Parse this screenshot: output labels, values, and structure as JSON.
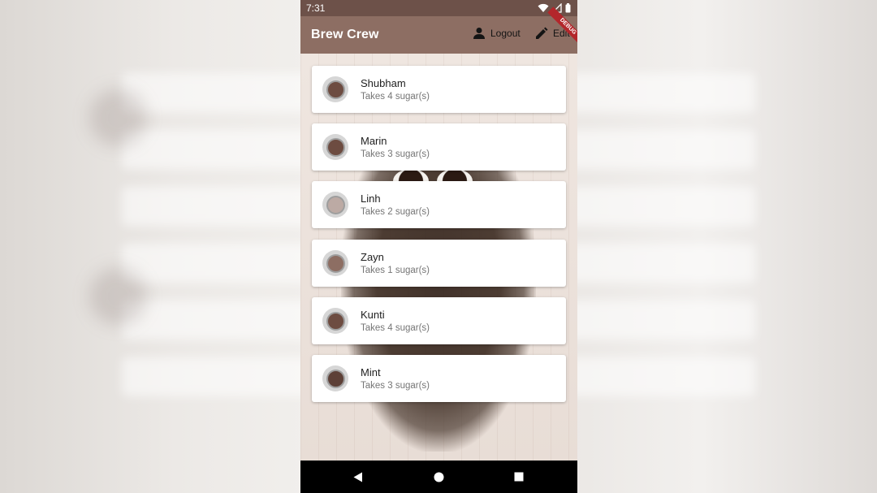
{
  "status_bar": {
    "time": "7:31"
  },
  "app_bar": {
    "title": "Brew Crew",
    "logout_label": "Logout",
    "edit_label": "Edit",
    "debug_banner": "DEBUG"
  },
  "brews": [
    {
      "name": "Shubham",
      "subtitle": "Takes 4 sugar(s)",
      "color": "#6d4c41"
    },
    {
      "name": "Marin",
      "subtitle": "Takes 3 sugar(s)",
      "color": "#6d4c41"
    },
    {
      "name": "Linh",
      "subtitle": "Takes 2 sugar(s)",
      "color": "#bcaaa4"
    },
    {
      "name": "Zayn",
      "subtitle": "Takes 1 sugar(s)",
      "color": "#8d6e63"
    },
    {
      "name": "Kunti",
      "subtitle": "Takes 4 sugar(s)",
      "color": "#6d4c41"
    },
    {
      "name": "Mint",
      "subtitle": "Takes 3 sugar(s)",
      "color": "#5d4037"
    }
  ],
  "colors": {
    "app_bar": "#8d6e63",
    "status_bar": "#6d5149"
  }
}
